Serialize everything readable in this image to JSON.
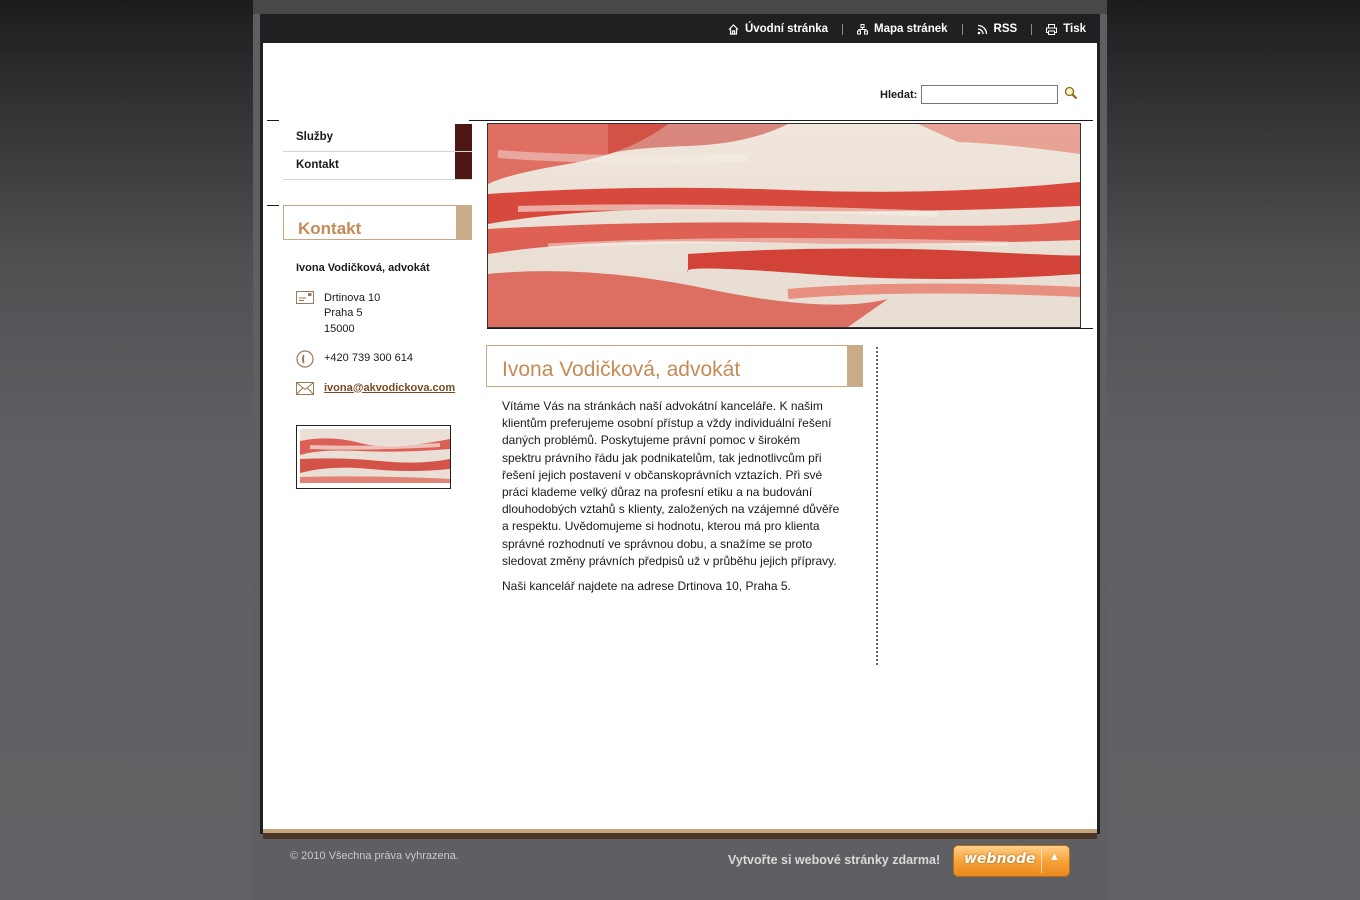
{
  "topnav": {
    "items": [
      {
        "label": "Úvodní stránka",
        "icon": "home-icon"
      },
      {
        "label": "Mapa stránek",
        "icon": "sitemap-icon"
      },
      {
        "label": "RSS",
        "icon": "rss-icon"
      },
      {
        "label": "Tisk",
        "icon": "print-icon"
      }
    ]
  },
  "search": {
    "label": "Hledat:",
    "value": "",
    "placeholder": "",
    "button_icon": "search-icon"
  },
  "sidebar": {
    "menu": [
      {
        "label": "Služby"
      },
      {
        "label": "Kontakt"
      }
    ],
    "contact_box": {
      "title": "Kontakt",
      "name": "Ivona Vodičková, advokát",
      "address": [
        "Drtinova 10",
        "Praha 5",
        "15000"
      ],
      "phone": "+420 739 300 614",
      "email": "ivona@akvodickova.com"
    }
  },
  "main": {
    "title": "Ivona Vodičková, advokát",
    "paragraphs": [
      "Vítáme Vás na stránkách naší advokátní kanceláře. K našim klientům preferujeme osobní přístup a vždy individuální řešení daných problémů. Poskytujeme právní pomoc v širokém spektru právního řádu jak podnikatelům, tak jednotlivcům při řešení jejich postavení v občanskoprávních vztazích. Při své práci klademe velký důraz na profesní etiku a na budování dlouhodobých vztahů s klienty, založených na vzájemné důvěře a respektu. Uvědomujeme si hodnotu, kterou má pro klienta správné rozhodnutí ve správnou dobu, a snažíme se proto sledovat změny právních předpisů už v průběhu jejich přípravy.",
      "Naši kancelář najdete na adrese Drtinova 10, Praha 5."
    ]
  },
  "footer": {
    "copyright": "© 2010 Všechna práva vyhrazena.",
    "promo": "Vytvořte si webové stránky zdarma!",
    "webnode_logo": "webnode",
    "webnode_arrow": "▲"
  },
  "colors": {
    "accent_title": "#c68b55",
    "accent_bar": "#c9ab8a",
    "nav_tab": "#4c1714",
    "frame": "#1f2021"
  }
}
